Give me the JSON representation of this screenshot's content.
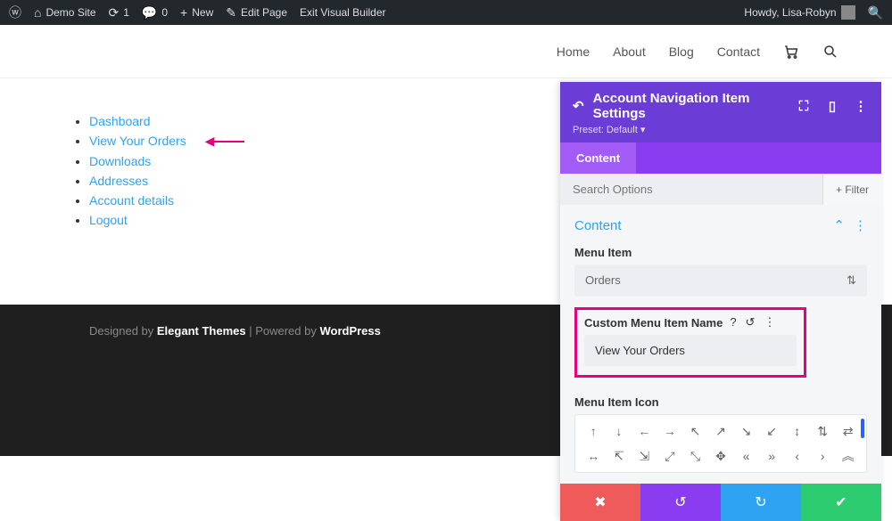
{
  "wp_bar": {
    "site_name": "Demo Site",
    "updates": "1",
    "comments": "0",
    "new": "New",
    "edit": "Edit Page",
    "exit_vb": "Exit Visual Builder",
    "howdy": "Howdy, Lisa-Robyn"
  },
  "nav": {
    "home": "Home",
    "about": "About",
    "blog": "Blog",
    "contact": "Contact"
  },
  "account_menu": [
    "Dashboard",
    "View Your Orders",
    "Downloads",
    "Addresses",
    "Account details",
    "Logout"
  ],
  "footer": {
    "designed": "Designed by ",
    "et": "Elegant Themes",
    "sep": " | Powered by ",
    "wp": "WordPress"
  },
  "panel": {
    "title": "Account Navigation Item Settings",
    "preset_label": "Preset:",
    "preset_value": "Default",
    "tab_content": "Content",
    "search_ph": "Search Options",
    "filter": "Filter",
    "section_content": "Content",
    "menu_item_label": "Menu Item",
    "menu_item_value": "Orders",
    "custom_name_label": "Custom Menu Item Name",
    "custom_name_value": "View Your Orders",
    "icon_label": "Menu Item Icon",
    "icons_row1": [
      "↑",
      "↓",
      "←",
      "→",
      "↖",
      "↗",
      "↘",
      "↙",
      "↕",
      "⇅",
      "⇄"
    ],
    "icons_row2": [
      "↔",
      "↸",
      "⇲",
      "⤢",
      "⤡",
      "✥",
      "«",
      "»",
      "‹",
      "›",
      "︽"
    ]
  }
}
